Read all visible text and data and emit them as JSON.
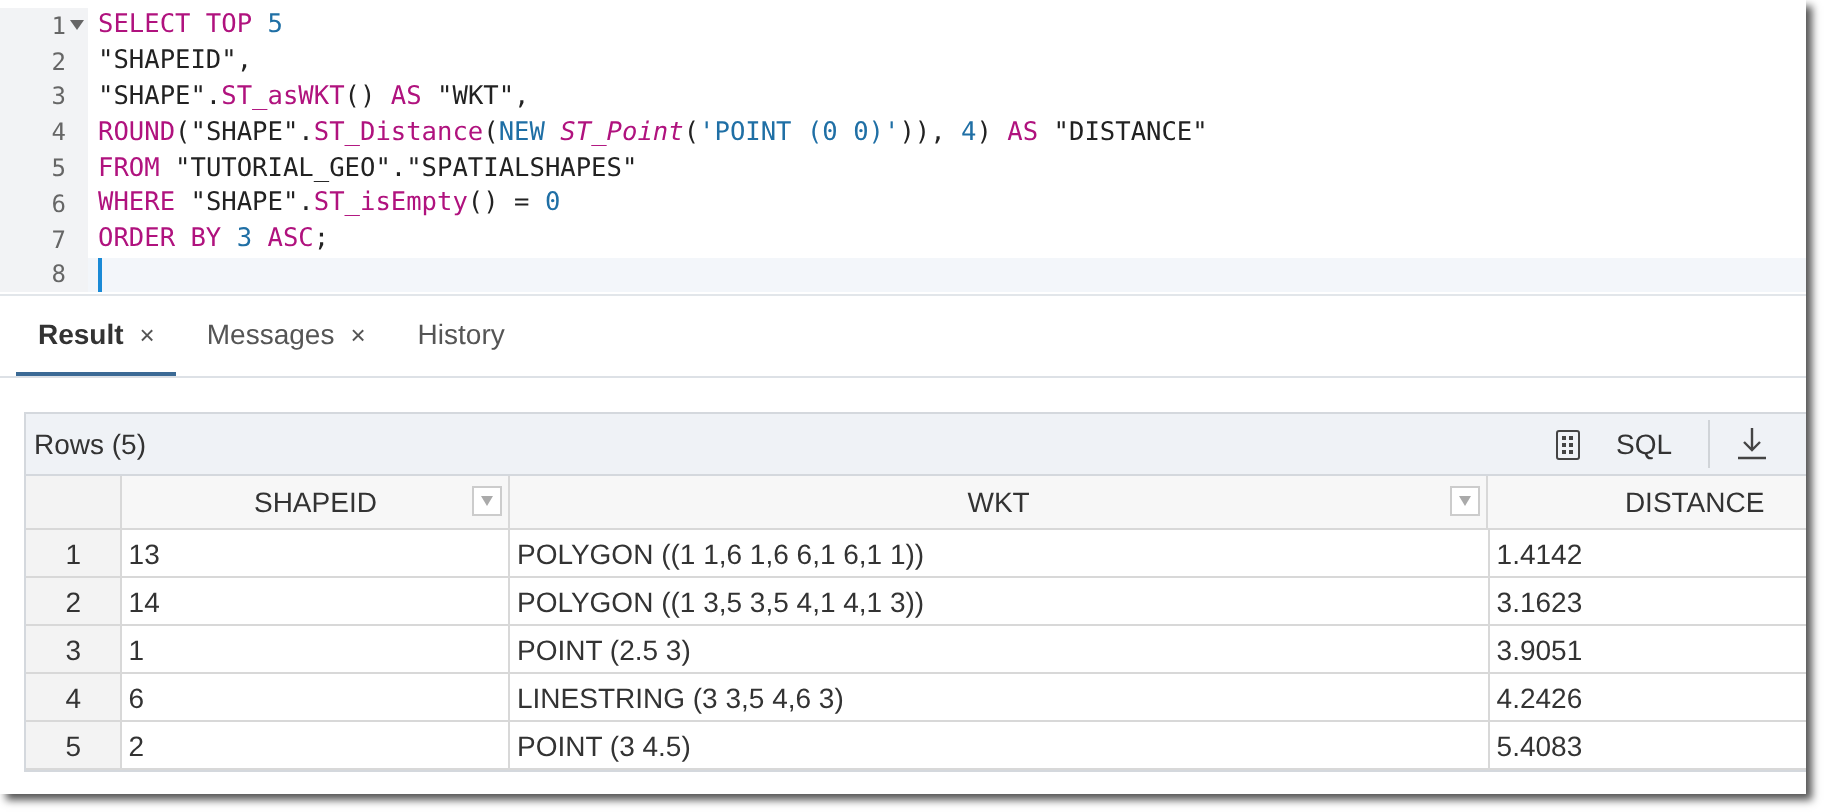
{
  "editor": {
    "lines": [
      {
        "number": "1",
        "foldable": true,
        "tokens": [
          {
            "text": "SELECT TOP ",
            "kind": "keyword"
          },
          {
            "text": "5",
            "kind": "number"
          }
        ]
      },
      {
        "number": "2",
        "foldable": false,
        "tokens": [
          {
            "text": "\"SHAPEID\",",
            "kind": "plain"
          }
        ]
      },
      {
        "number": "3",
        "foldable": false,
        "tokens": [
          {
            "text": "\"SHAPE\".",
            "kind": "plain"
          },
          {
            "text": "ST_asWKT",
            "kind": "keyword"
          },
          {
            "text": "() ",
            "kind": "plain"
          },
          {
            "text": "AS",
            "kind": "keyword"
          },
          {
            "text": " \"WKT\",",
            "kind": "plain"
          }
        ]
      },
      {
        "number": "4",
        "foldable": false,
        "tokens": [
          {
            "text": "ROUND",
            "kind": "keyword"
          },
          {
            "text": "(\"SHAPE\".",
            "kind": "plain"
          },
          {
            "text": "ST_Distance",
            "kind": "keyword"
          },
          {
            "text": "(",
            "kind": "plain"
          },
          {
            "text": "NEW ",
            "kind": "number"
          },
          {
            "text": "ST_Point",
            "kind": "type"
          },
          {
            "text": "(",
            "kind": "plain"
          },
          {
            "text": "'POINT (0 0)'",
            "kind": "number"
          },
          {
            "text": ")), ",
            "kind": "plain"
          },
          {
            "text": "4",
            "kind": "number"
          },
          {
            "text": ") ",
            "kind": "plain"
          },
          {
            "text": "AS",
            "kind": "keyword"
          },
          {
            "text": " \"DISTANCE\"",
            "kind": "plain"
          }
        ]
      },
      {
        "number": "5",
        "foldable": false,
        "tokens": [
          {
            "text": "FROM",
            "kind": "keyword"
          },
          {
            "text": " \"TUTORIAL_GEO\".\"SPATIALSHAPES\"",
            "kind": "plain"
          }
        ]
      },
      {
        "number": "6",
        "foldable": false,
        "tokens": [
          {
            "text": "WHERE",
            "kind": "keyword"
          },
          {
            "text": " \"SHAPE\".",
            "kind": "plain"
          },
          {
            "text": "ST_isEmpty",
            "kind": "keyword"
          },
          {
            "text": "() = ",
            "kind": "plain"
          },
          {
            "text": "0",
            "kind": "number"
          }
        ]
      },
      {
        "number": "7",
        "foldable": false,
        "tokens": [
          {
            "text": "ORDER BY ",
            "kind": "keyword"
          },
          {
            "text": "3 ",
            "kind": "number"
          },
          {
            "text": "ASC",
            "kind": "keyword"
          },
          {
            "text": ";",
            "kind": "plain"
          }
        ]
      },
      {
        "number": "8",
        "foldable": false,
        "active": true
      }
    ]
  },
  "tabs": [
    {
      "label": "Result",
      "closable": true,
      "selected": true
    },
    {
      "label": "Messages",
      "closable": true,
      "selected": false
    },
    {
      "label": "History",
      "closable": false,
      "selected": false
    }
  ],
  "close_glyph": "×",
  "result": {
    "title": "Rows (5)",
    "sql_button": "SQL",
    "columns": [
      {
        "filter": false
      },
      {
        "label": "SHAPEID",
        "filter": true
      },
      {
        "label": "WKT",
        "filter": true
      },
      {
        "label": "DISTANCE",
        "filter": false
      }
    ],
    "rows": [
      [
        "1",
        "13",
        "POLYGON ((1 1,6 1,6 6,1 6,1 1))",
        "1.4142"
      ],
      [
        "2",
        "14",
        "POLYGON ((1 3,5 3,5 4,1 4,1 3))",
        "3.1623"
      ],
      [
        "3",
        "1",
        "POINT (2.5 3)",
        "3.9051"
      ],
      [
        "4",
        "6",
        "LINESTRING (3 3,5 4,6 3)",
        "4.2426"
      ],
      [
        "5",
        "2",
        "POINT (3 4.5)",
        "5.4083"
      ]
    ]
  }
}
